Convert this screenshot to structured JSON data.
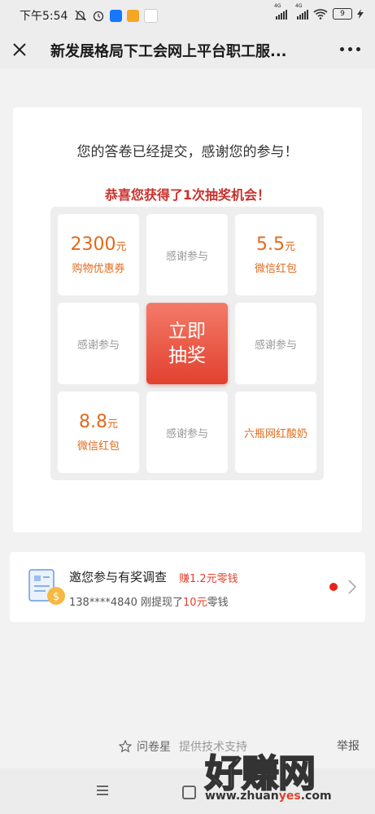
{
  "status_bar": {
    "time": "下午5:54",
    "battery": "9",
    "network_a": "4G",
    "network_b": "4G"
  },
  "nav": {
    "title": "新发展格局下工会网上平台职工服..."
  },
  "lottery": {
    "submitted_text": "您的答卷已经提交，感谢您的参与！",
    "congrats_text": "恭喜您获得了1次抽奖机会！",
    "draw_button": "立即抽奖",
    "prizes": {
      "p1_amount": "2300",
      "p1_unit": "元",
      "p1_desc": "购物优惠券",
      "p2": "感谢参与",
      "p3_amount": "5.5",
      "p3_unit": "元",
      "p3_desc": "微信红包",
      "p4": "感谢参与",
      "p6": "感谢参与",
      "p7_amount": "8.8",
      "p7_unit": "元",
      "p7_desc": "微信红包",
      "p8": "感谢参与",
      "p9": "六瓶网红酸奶"
    }
  },
  "survey": {
    "title": "邀您参与有奖调查",
    "earn": "赚1.2元零钱",
    "withdraw_prefix": "138****4840 刚提现了",
    "withdraw_amount": "10元",
    "withdraw_suffix": "零钱"
  },
  "footer": {
    "brand": "问卷星",
    "tech": "提供技术支持",
    "report": "举报"
  },
  "watermark": {
    "big": "好赚网",
    "url_a": "www.zhuan",
    "url_b": "yes",
    "url_c": ".com"
  },
  "colors": {
    "accent_red": "#e2412f",
    "prize_orange": "#e26a1b",
    "congrats_red": "#c9302c"
  }
}
